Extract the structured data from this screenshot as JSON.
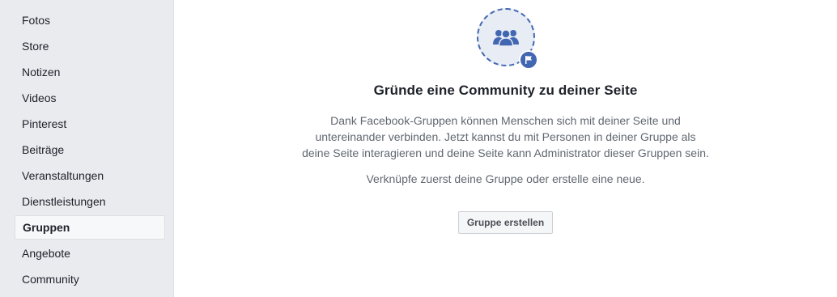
{
  "sidebar": {
    "items": [
      {
        "label": "Fotos",
        "active": false
      },
      {
        "label": "Store",
        "active": false
      },
      {
        "label": "Notizen",
        "active": false
      },
      {
        "label": "Videos",
        "active": false
      },
      {
        "label": "Pinterest",
        "active": false
      },
      {
        "label": "Beiträge",
        "active": false
      },
      {
        "label": "Veranstaltungen",
        "active": false
      },
      {
        "label": "Dienstleistungen",
        "active": false
      },
      {
        "label": "Gruppen",
        "active": true
      },
      {
        "label": "Angebote",
        "active": false
      },
      {
        "label": "Community",
        "active": false
      }
    ]
  },
  "main": {
    "illustration": {
      "icon": "group-icon",
      "badge_icon": "flag-icon"
    },
    "headline": "Gründe eine Community zu deiner Seite",
    "description_lines": [
      "Dank Facebook-Gruppen können Menschen sich mit deiner Seite und",
      "untereinander verbinden. Jetzt kannst du mit Personen in deiner Gruppe als",
      "deine Seite interagieren und deine Seite kann Administrator dieser Gruppen sein."
    ],
    "hint": "Verknüpfe zuerst deine Gruppe oder erstelle eine neue.",
    "create_button": "Gruppe erstellen"
  },
  "colors": {
    "accent": "#4267b2",
    "sidebar_bg": "#e9ebee",
    "text_primary": "#1d2129",
    "text_secondary": "#606770"
  }
}
